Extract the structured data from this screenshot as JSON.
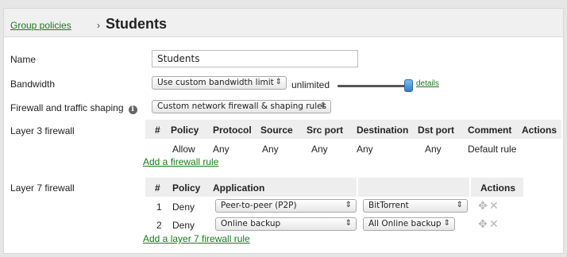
{
  "header": {
    "breadcrumb": "Group policies",
    "separator": "›",
    "title": "Students"
  },
  "name_row": {
    "label": "Name",
    "value": "Students"
  },
  "bandwidth_row": {
    "label": "Bandwidth",
    "select_value": "Use custom bandwidth limit",
    "limit_text": "unlimited",
    "slider_level": 1.0,
    "details_link": "details"
  },
  "firewall_row": {
    "label": "Firewall and traffic shaping",
    "info_icon": "info-icon",
    "select_value": "Custom network firewall & shaping rules"
  },
  "layer3": {
    "label": "Layer 3 firewall",
    "columns": [
      "#",
      "Policy",
      "Protocol",
      "Source",
      "Src port",
      "Destination",
      "Dst port",
      "Comment",
      "Actions"
    ],
    "rows": [
      {
        "num": "",
        "policy": "Allow",
        "protocol": "Any",
        "source": "Any",
        "src_port": "Any",
        "destination": "Any",
        "dst_port": "Any",
        "comment": "Default rule"
      }
    ],
    "add_link": "Add a firewall rule"
  },
  "layer7": {
    "label": "Layer 7 firewall",
    "columns": [
      "#",
      "Policy",
      "Application",
      "",
      "Actions"
    ],
    "rows": [
      {
        "num": "1",
        "policy": "Deny",
        "application": "Peer-to-peer (P2P)",
        "detail": "BitTorrent"
      },
      {
        "num": "2",
        "policy": "Deny",
        "application": "Online backup",
        "detail": "All Online backup"
      }
    ],
    "add_link": "Add a layer 7 firewall rule"
  },
  "select_arrow": "⇕",
  "icons": {
    "move": "✥",
    "delete": "✕"
  },
  "colors": {
    "link": "#1a7a1a",
    "header_bg": "#f0f0f0",
    "table_header_bg": "#eeeeee"
  }
}
